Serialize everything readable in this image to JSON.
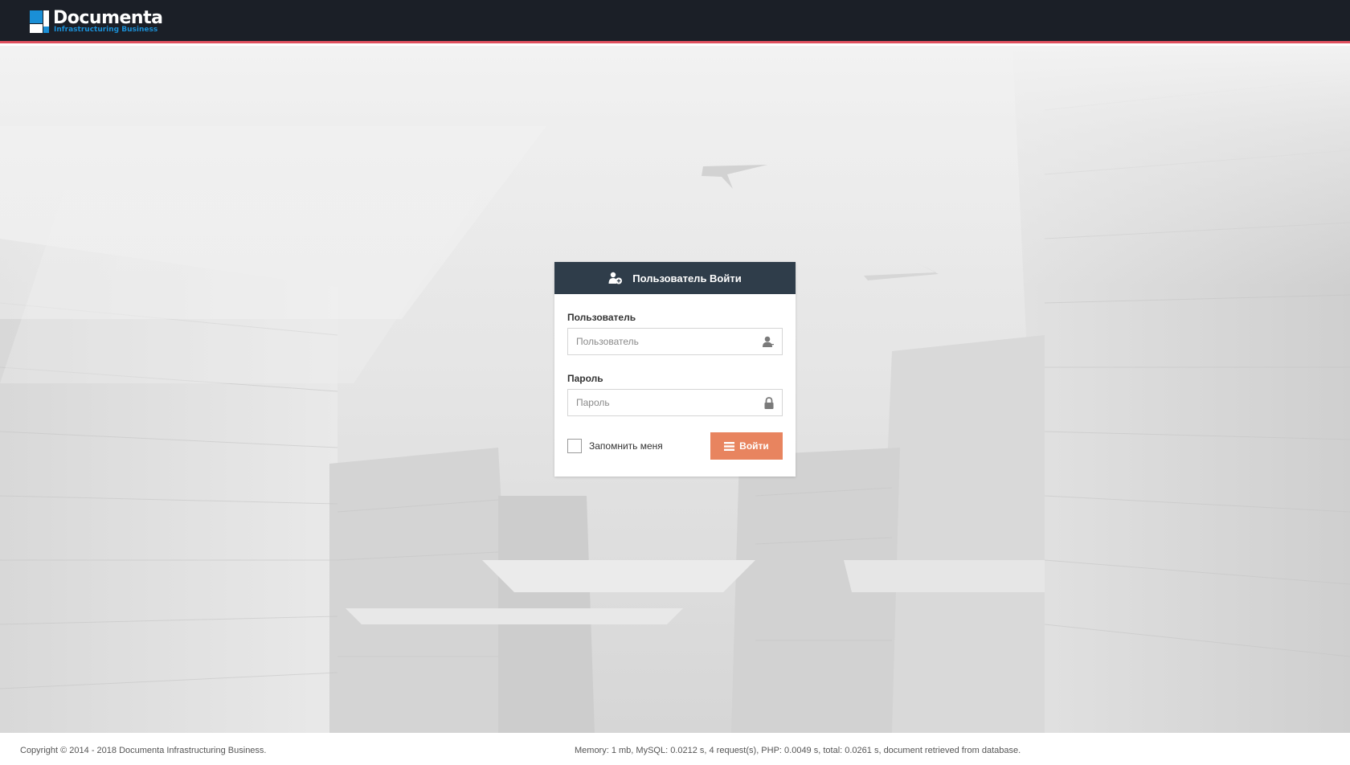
{
  "brand": {
    "name": "Documenta",
    "tagline": "Infrastructuring Business",
    "accent": "#1a8fd6",
    "header_bg": "#1b1f27",
    "header_border": "#e0505e"
  },
  "login": {
    "title": "Пользователь Войти",
    "title_icon": "user-add-icon",
    "header_bg": "#2f3d4a",
    "username": {
      "label": "Пользователь",
      "placeholder": "Пользователь",
      "value": "",
      "icon": "user-icon"
    },
    "password": {
      "label": "Пароль",
      "placeholder": "Пароль",
      "value": "",
      "icon": "lock-icon"
    },
    "remember_label": "Запомнить меня",
    "remember_checked": false,
    "submit_label": "Войти",
    "submit_icon": "menu-icon",
    "submit_color": "#e8845f"
  },
  "footer": {
    "copyright": "Copyright © 2014 - 2018 Documenta Infrastructuring Business.",
    "stats": "Memory: 1 mb, MySQL: 0.0212 s, 4 request(s), PHP: 0.0049 s, total: 0.0261 s, document retrieved from database."
  }
}
